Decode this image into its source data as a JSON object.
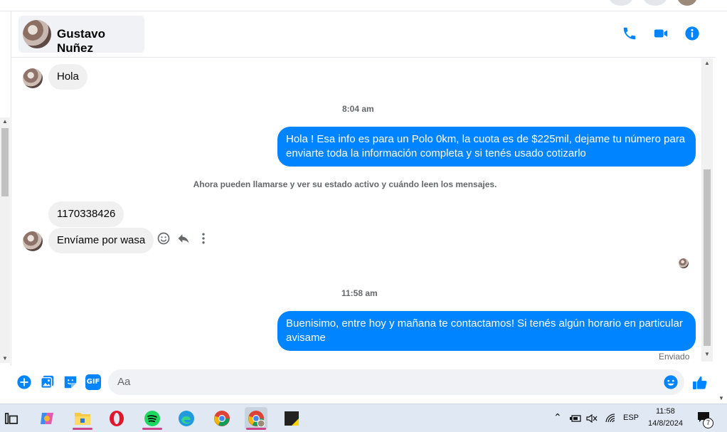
{
  "header": {
    "contact_name": "Gustavo Nuñez"
  },
  "messages": {
    "in_hola": "Hola",
    "ts_1": "8:04 am",
    "out_1": "Hola ! Esa info es para un Polo 0km, la cuota es de $225mil, dejame tu número para enviarte toda la información completa y si tenés usado cotizarlo",
    "system": "Ahora pueden llamarse y ver su estado activo y cuándo leen los mensajes.",
    "in_number": "1170338426",
    "in_wasa": "Envíame por wasa",
    "ts_2": "11:58 am",
    "out_2": "Buenisimo, entre hoy y mañana te contactamos! Si tenés algún horario en particular avisame",
    "status": "Enviado"
  },
  "composer": {
    "placeholder": "Aa",
    "gif_label": "GIF"
  },
  "taskbar": {
    "lang": "ESP",
    "time": "11:58",
    "date": "14/8/2024",
    "notif_count": "7"
  },
  "colors": {
    "accent": "#0084ff",
    "incoming_bubble": "#f0f0f0",
    "text_secondary": "#65676b"
  },
  "icons": [
    "phone-icon",
    "video-icon",
    "info-icon",
    "plus-icon",
    "photo-icon",
    "sticker-icon",
    "gif-icon",
    "emoji-icon",
    "like-icon",
    "react-icon",
    "reply-icon",
    "more-icon"
  ]
}
